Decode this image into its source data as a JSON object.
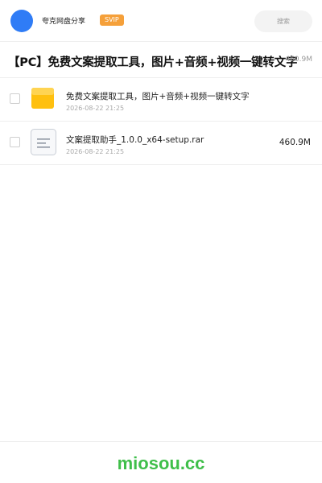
{
  "header": {
    "username": "夸克网盘分享",
    "badge": "SVIP",
    "search_label": "搜索",
    "avatar_color": "#2f7cf6",
    "badge_color": "#f5a03a"
  },
  "share": {
    "title": "【PC】免费文案提取工具，图片+音频+视频一键转文字",
    "total_size": "460.9M"
  },
  "files": [
    {
      "name": "免费文案提取工具，图片+音频+视频一键转文字",
      "date": "2026-08-22 21:25",
      "size": "",
      "icon": "folder-icon"
    },
    {
      "name": "文案提取助手_1.0.0_x64-setup.rar",
      "date": "2026-08-22 21:25",
      "size": "460.9M",
      "icon": "archive-file-icon"
    }
  ],
  "footer": {
    "brand": "miosou.cc",
    "brand_color": "#3fbf4a"
  }
}
